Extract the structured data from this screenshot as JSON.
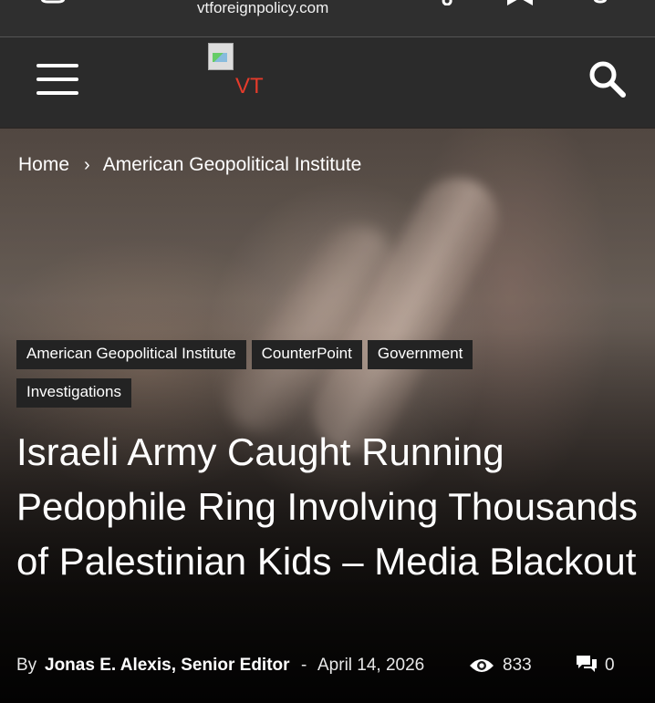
{
  "topbar": {
    "url": "vtforeignpolicy.com"
  },
  "header": {
    "menu_icon": "hamburger-menu-icon",
    "logo_alt": "VT",
    "search_icon": "search-icon"
  },
  "breadcrumb": {
    "home": "Home",
    "separator": "›",
    "current": "American Geopolitical Institute"
  },
  "tags": [
    "American Geopolitical Institute",
    "CounterPoint",
    "Government",
    "Investigations"
  ],
  "article": {
    "title": "Israeli Army Caught Running Pedophile Ring Involving Thousands of Palestinian Kids – Media Blackout",
    "by_label": "By",
    "author": "Jonas E. Alexis, Senior Editor",
    "dash": "-",
    "date": "April 14, 2026",
    "views": "833",
    "comments": "0"
  },
  "colors": {
    "header_bg": "#2b2b2b",
    "tag_bg": "#232323",
    "logo_alt_color": "#e53b2b"
  }
}
